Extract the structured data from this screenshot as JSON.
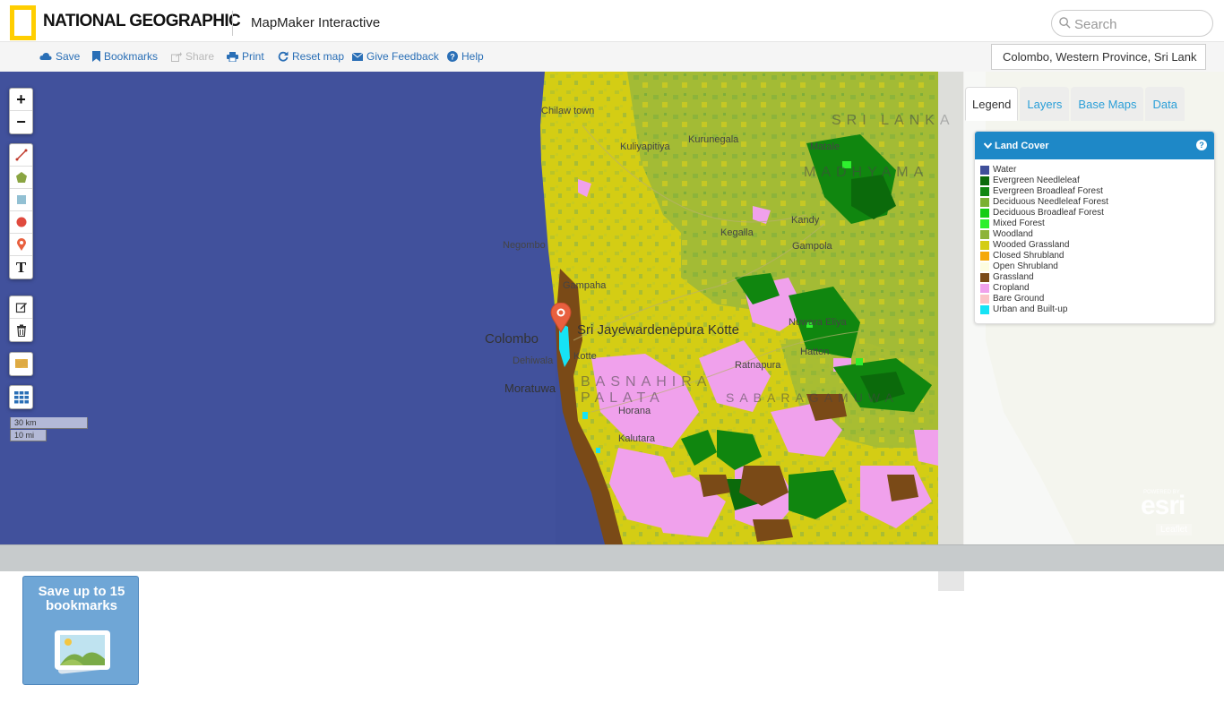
{
  "header": {
    "brand": "NATIONAL GEOGRAPHIC",
    "app_title": "MapMaker Interactive",
    "search_placeholder": "Search"
  },
  "toolbar": {
    "save": "Save",
    "bookmarks": "Bookmarks",
    "share": "Share",
    "print": "Print",
    "reset_map": "Reset map",
    "feedback": "Give Feedback",
    "help": "Help",
    "location": "Colombo, Western Province, Sri Lank"
  },
  "controls": {
    "zoom_in": "+",
    "zoom_out": "−",
    "text_tool": "T",
    "scale_km": "30 km",
    "scale_mi": "10 mi"
  },
  "map_labels": {
    "chilaw": "Chilaw town",
    "kuliyapitiya": "Kuliyapitiya",
    "kurunegala": "Kurunegala",
    "matale": "Matale",
    "negombo": "Negombo",
    "kegalla": "Kegalla",
    "kandy": "Kandy",
    "gampola": "Gampola",
    "gampaha": "Gampaha",
    "colombo": "Colombo",
    "kotte": "Sri Jayewardenepura Kotte",
    "dehiwala": "Dehiwala",
    "kotte_small": "Kotte",
    "moratuwa": "Moratuwa",
    "horana": "Horana",
    "kalutara": "Kalutara",
    "ratnapura": "Ratnapura",
    "hatton": "Hatton",
    "nuwara": "Nuwara Eliya",
    "region1": "SRI LANKA",
    "region2": "MADHYAMA",
    "region3": "BASNAHIRA PALATA",
    "region4": "SABARAGAMUWA"
  },
  "panel": {
    "tabs": [
      "Legend",
      "Layers",
      "Base Maps",
      "Data"
    ],
    "active_tab": "Legend",
    "legend_title": "Land Cover",
    "legend_items": [
      {
        "label": "Water",
        "color": "#3f4f9a"
      },
      {
        "label": "Evergreen Needleleaf",
        "color": "#0b6a0b"
      },
      {
        "label": "Evergreen Broadleaf Forest",
        "color": "#10860f"
      },
      {
        "label": "Deciduous Needleleaf Forest",
        "color": "#7ab032"
      },
      {
        "label": "Deciduous Broadleaf Forest",
        "color": "#16cc16"
      },
      {
        "label": "Mixed Forest",
        "color": "#2ef02e"
      },
      {
        "label": "Woodland",
        "color": "#8db43a"
      },
      {
        "label": "Wooded Grassland",
        "color": "#d4cd14"
      },
      {
        "label": "Closed Shrubland",
        "color": "#f5a90c"
      },
      {
        "label": "Open Shrubland",
        "color": "#fdfde0"
      },
      {
        "label": "Grassland",
        "color": "#7a4a17"
      },
      {
        "label": "Cropland",
        "color": "#f0a1ec"
      },
      {
        "label": "Bare Ground",
        "color": "#fbc3c7"
      },
      {
        "label": "Urban and Built-up",
        "color": "#16e3f5"
      }
    ]
  },
  "attribution": {
    "powered": "POWERED BY",
    "esri": "esri",
    "leaflet": "Leaflet"
  },
  "promo": {
    "text": "Save up to 15 bookmarks"
  }
}
